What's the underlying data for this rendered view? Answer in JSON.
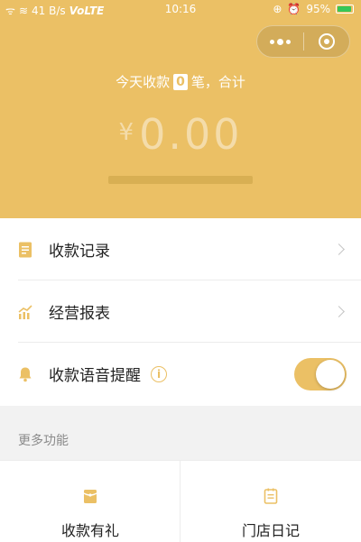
{
  "status_bar": {
    "signal": "ᯤ",
    "wifi": "≋",
    "speed": "41 B/s",
    "network": "VoLTE",
    "time": "10:16",
    "battery": "95%"
  },
  "capsule": {
    "more_icon": "more-dots-icon",
    "close_icon": "mini-program-close-icon"
  },
  "summary": {
    "prefix": "今天收款",
    "count": "0",
    "suffix": "笔，合计",
    "currency": "¥",
    "amount": "0.00"
  },
  "menu": [
    {
      "label": "收款记录",
      "icon": "receipt-icon"
    },
    {
      "label": "经营报表",
      "icon": "report-chart-icon"
    },
    {
      "label": "收款语音提醒",
      "icon": "bell-icon",
      "info": "i",
      "toggle_on": true
    }
  ],
  "more": {
    "title": "更多功能",
    "items": [
      {
        "label": "收款有礼",
        "icon": "gift-icon"
      },
      {
        "label": "门店日记",
        "icon": "diary-icon"
      }
    ]
  },
  "colors": {
    "accent": "#ebc065",
    "background": "#f2f2f2"
  }
}
